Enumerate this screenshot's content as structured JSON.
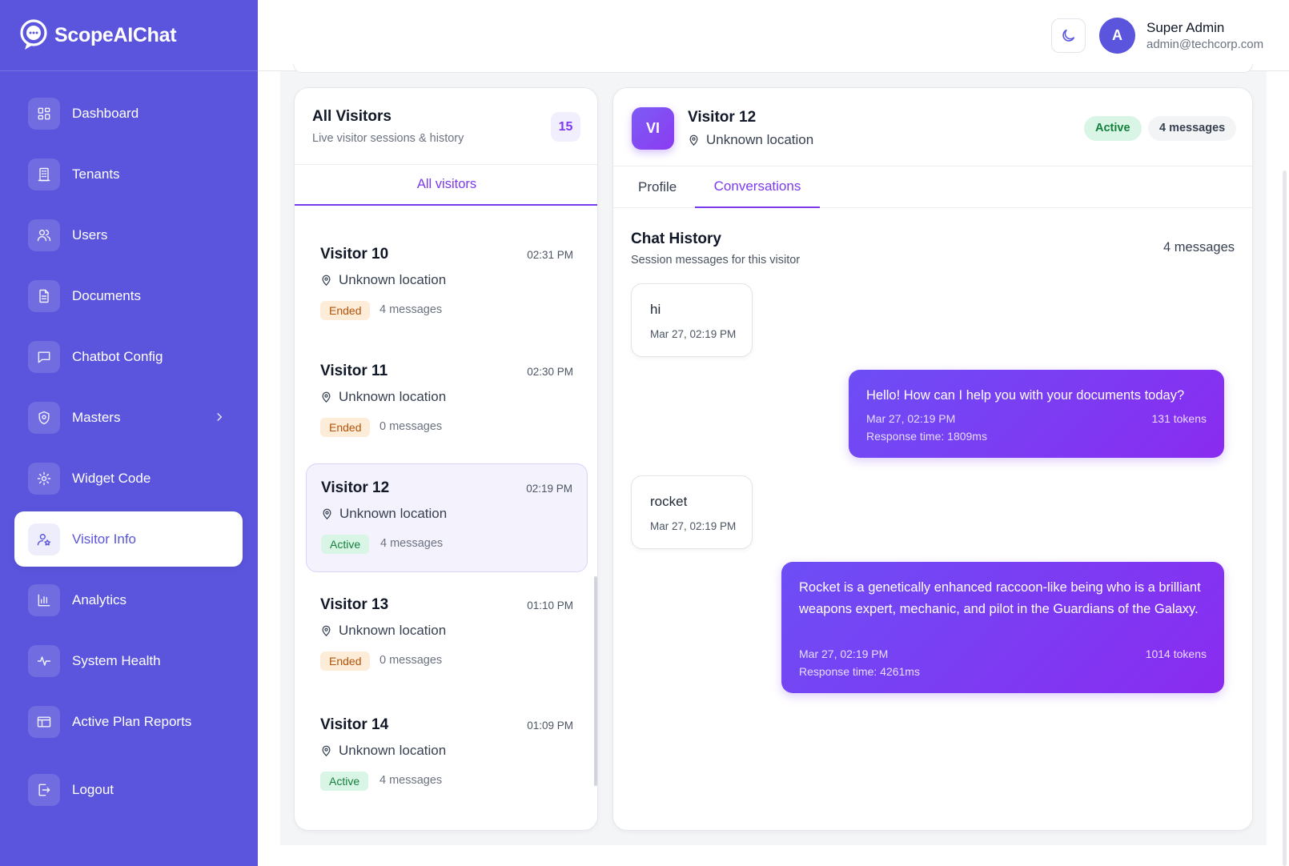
{
  "brand": {
    "name": "ScopeAIChat"
  },
  "sidebar": {
    "items": [
      {
        "label": "Dashboard",
        "icon": "grid-icon"
      },
      {
        "label": "Tenants",
        "icon": "building-icon"
      },
      {
        "label": "Users",
        "icon": "users-icon"
      },
      {
        "label": "Documents",
        "icon": "document-icon"
      },
      {
        "label": "Chatbot Config",
        "icon": "chat-icon"
      },
      {
        "label": "Masters",
        "icon": "shield-icon",
        "has_submenu": true
      },
      {
        "label": "Widget Code",
        "icon": "gear-icon"
      },
      {
        "label": "Visitor Info",
        "icon": "user-star-icon",
        "active": true
      },
      {
        "label": "Analytics",
        "icon": "bar-chart-icon"
      },
      {
        "label": "System Health",
        "icon": "pulse-icon"
      },
      {
        "label": "Active Plan Reports",
        "icon": "layout-icon"
      },
      {
        "label": "Logout",
        "icon": "logout-icon"
      }
    ]
  },
  "header": {
    "avatar_initial": "A",
    "user_name": "Super Admin",
    "user_email": "admin@techcorp.com"
  },
  "visitors_panel": {
    "title": "All Visitors",
    "subtitle": "Live visitor sessions & history",
    "count": "15",
    "tab_label": "All visitors",
    "visitors": [
      {
        "name": "Visitor 10",
        "time": "02:31 PM",
        "location": "Unknown location",
        "status": "Ended",
        "messages": "4 messages"
      },
      {
        "name": "Visitor 11",
        "time": "02:30 PM",
        "location": "Unknown location",
        "status": "Ended",
        "messages": "0 messages"
      },
      {
        "name": "Visitor 12",
        "time": "02:19 PM",
        "location": "Unknown location",
        "status": "Active",
        "messages": "4 messages",
        "selected": true
      },
      {
        "name": "Visitor 13",
        "time": "01:10 PM",
        "location": "Unknown location",
        "status": "Ended",
        "messages": "0 messages"
      },
      {
        "name": "Visitor 14",
        "time": "01:09 PM",
        "location": "Unknown location",
        "status": "Active",
        "messages": "4 messages"
      }
    ]
  },
  "detail": {
    "initials": "VI",
    "name": "Visitor 12",
    "location": "Unknown location",
    "status": "Active",
    "message_badge": "4 messages",
    "tabs": {
      "profile": "Profile",
      "conversations": "Conversations"
    },
    "chat_title": "Chat History",
    "chat_subtitle": "Session messages for this visitor",
    "chat_count": "4 messages",
    "messages": [
      {
        "role": "user",
        "text": "hi",
        "time": "Mar 27, 02:19 PM"
      },
      {
        "role": "bot",
        "text": "Hello! How can I help you with your documents today?",
        "time": "Mar 27, 02:19 PM",
        "tokens": "131 tokens",
        "response_time": "Response time: 1809ms"
      },
      {
        "role": "user",
        "text": "rocket",
        "time": "Mar 27, 02:19 PM"
      },
      {
        "role": "bot",
        "text": "Rocket is a genetically enhanced raccoon-like being who is a brilliant weapons expert, mechanic, and pilot in the Guardians of the Galaxy.",
        "time": "Mar 27, 02:19 PM",
        "tokens": "1014 tokens",
        "response_time": "Response time: 4261ms"
      }
    ]
  },
  "colors": {
    "sidebar": "#5a55dc",
    "accent": "#7c3aed",
    "active_green": "#15803d",
    "ended_orange": "#b45309"
  }
}
